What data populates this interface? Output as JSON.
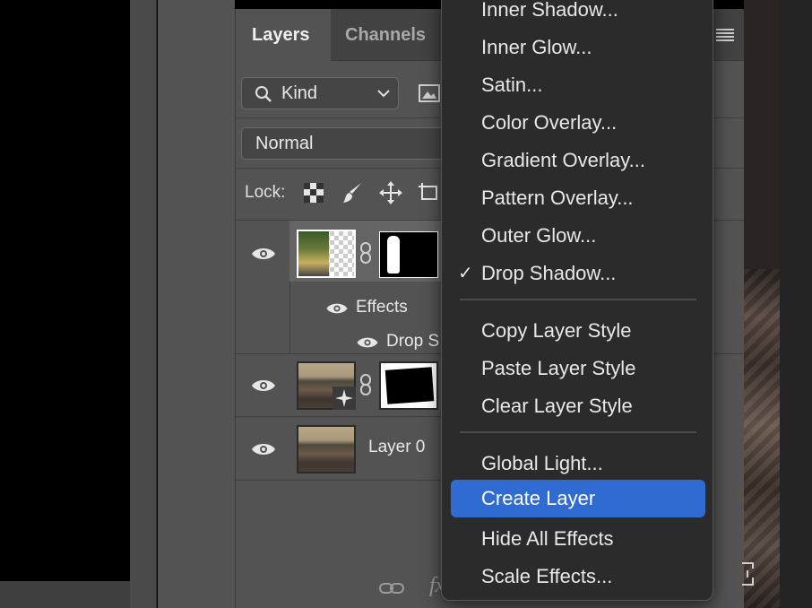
{
  "panel": {
    "tabs": [
      {
        "label": "Layers",
        "active": true
      },
      {
        "label": "Channels",
        "active": false
      }
    ],
    "filter": {
      "kind_label": "Kind"
    },
    "blend_mode": "Normal",
    "lock_label": "Lock:",
    "layers": [
      {
        "name": "",
        "effects_label": "Effects",
        "effect_item": "Drop S",
        "selected": true
      },
      {
        "name": ""
      },
      {
        "name": "Layer 0"
      }
    ]
  },
  "context_menu": {
    "items": [
      {
        "label": "Inner Shadow...",
        "checked": false
      },
      {
        "label": "Inner Glow...",
        "checked": false
      },
      {
        "label": "Satin...",
        "checked": false
      },
      {
        "label": "Color Overlay...",
        "checked": false
      },
      {
        "label": "Gradient Overlay...",
        "checked": false
      },
      {
        "label": "Pattern Overlay...",
        "checked": false
      },
      {
        "label": "Outer Glow...",
        "checked": false
      },
      {
        "label": "Drop Shadow...",
        "checked": true
      },
      {
        "label": "Copy Layer Style"
      },
      {
        "label": "Paste Layer Style"
      },
      {
        "label": "Clear Layer Style"
      },
      {
        "label": "Global Light..."
      },
      {
        "label": "Create Layer",
        "highlighted": true
      },
      {
        "label": "Hide All Effects"
      },
      {
        "label": "Scale Effects..."
      }
    ],
    "checkmark": "✓",
    "highlight_color": "#2f6bd1"
  },
  "bottom_bar": {
    "fx_label": "fx"
  }
}
